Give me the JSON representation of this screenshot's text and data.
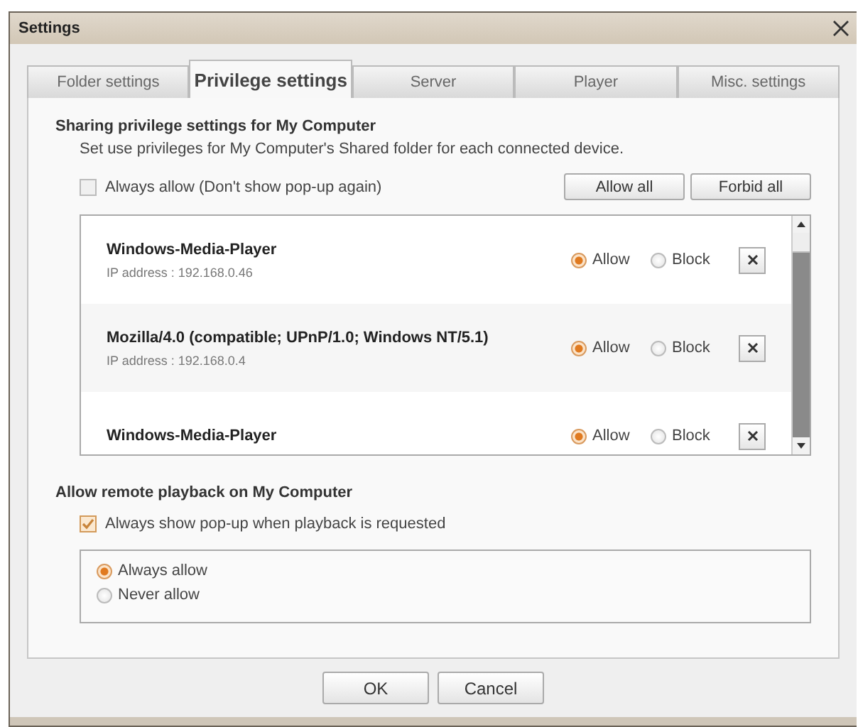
{
  "window": {
    "title": "Settings"
  },
  "tabs": [
    {
      "label": "Folder settings",
      "selected": false
    },
    {
      "label": "Privilege settings",
      "selected": true
    },
    {
      "label": "Server",
      "selected": false
    },
    {
      "label": "Player",
      "selected": false
    },
    {
      "label": "Misc. settings",
      "selected": false
    }
  ],
  "sharing": {
    "heading": "Sharing privilege settings for My Computer",
    "description": "Set use privileges for My Computer's Shared folder for each connected device.",
    "always_allow": {
      "label": "Always allow (Don't show pop-up again)",
      "checked": false
    },
    "buttons": [
      "Allow all",
      "Forbid all"
    ],
    "devices": [
      {
        "name": "Windows-Media-Player",
        "ip": "IP address : 192.168.0.46",
        "options": [
          {
            "label": "Allow",
            "selected": true
          },
          {
            "label": "Block",
            "selected": false
          }
        ]
      },
      {
        "name": "Mozilla/4.0 (compatible; UPnP/1.0; Windows NT/5.1)",
        "ip": "IP address : 192.168.0.4",
        "options": [
          {
            "label": "Allow",
            "selected": true
          },
          {
            "label": "Block",
            "selected": false
          }
        ]
      },
      {
        "name": "Windows-Media-Player",
        "options": [
          {
            "label": "Allow",
            "selected": true
          },
          {
            "label": "Block",
            "selected": false
          }
        ]
      }
    ]
  },
  "remote": {
    "heading": "Allow remote playback on My Computer",
    "popup": {
      "label": "Always show pop-up when playback is requested",
      "checked": true
    },
    "options": [
      {
        "label": "Always allow",
        "selected": true
      },
      {
        "label": "Never allow",
        "selected": false
      }
    ]
  },
  "buttons": [
    "OK",
    "Cancel"
  ]
}
